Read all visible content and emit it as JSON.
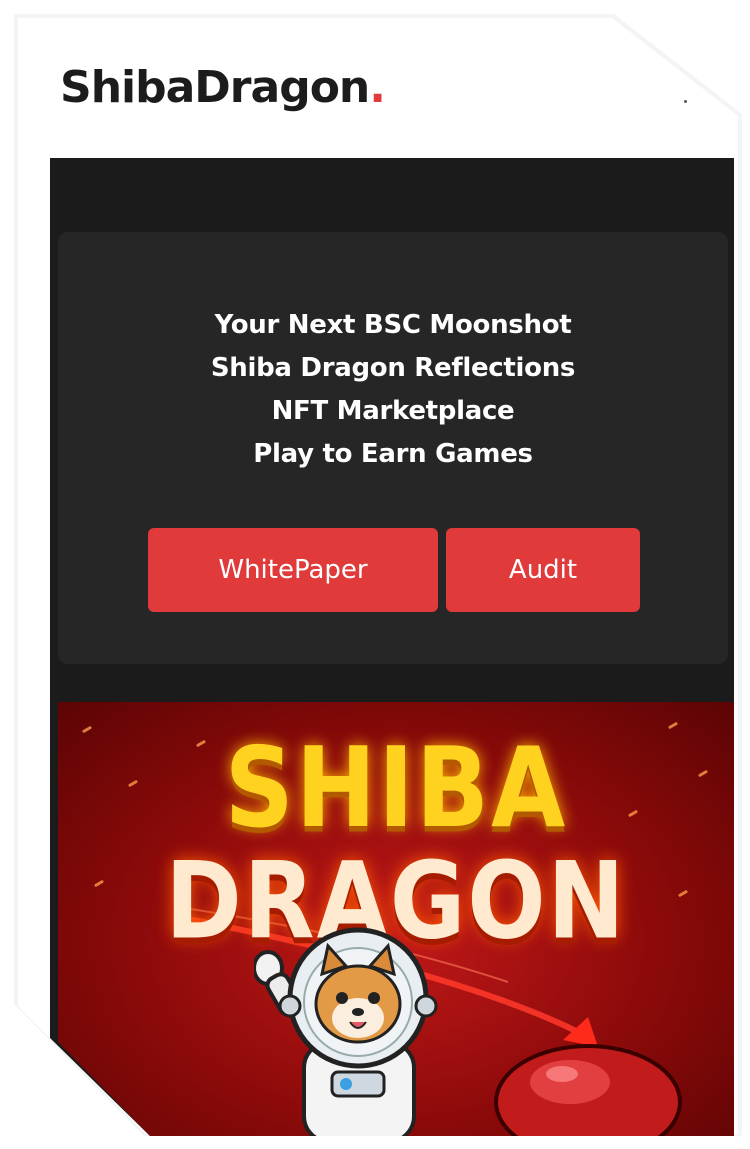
{
  "brand": {
    "name": "ShibaDragon",
    "dot": ".",
    "accent_color": "#e23b3b"
  },
  "hero": {
    "lines": [
      "Your Next BSC Moonshot",
      "Shiba Dragon Reflections",
      "NFT Marketplace",
      "Play to Earn Games"
    ],
    "buttons": {
      "whitepaper": "WhitePaper",
      "audit": "Audit"
    },
    "button_color": "#e03a3a",
    "card_color": "#262626"
  },
  "banner": {
    "title_line_1": "SHIBA",
    "title_line_2": "DRAGON",
    "character": "shiba-astronaut-icon"
  },
  "icons": {
    "menu": "menu-dot-icon"
  }
}
